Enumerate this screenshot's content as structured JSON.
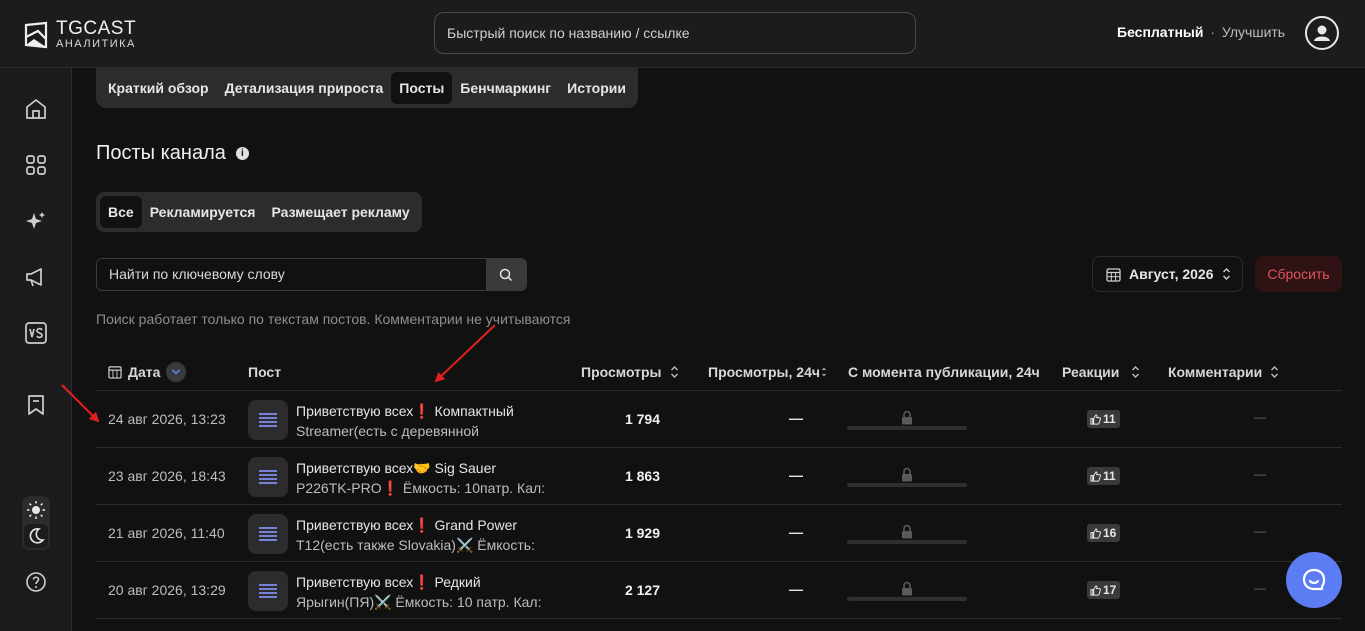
{
  "header": {
    "logo_line1": "TGCAST",
    "logo_line2": "АНАЛИТИКА",
    "search_placeholder": "Быстрый поиск по названию / ссылке",
    "plan_label": "Бесплатный",
    "plan_separator": "·",
    "upgrade_label": "Улучшить"
  },
  "sidebar": {
    "items": [
      {
        "icon": "home-icon"
      },
      {
        "icon": "grid-icon"
      },
      {
        "icon": "sparkles-icon"
      },
      {
        "icon": "megaphone-icon"
      },
      {
        "icon": "vs-icon"
      },
      {
        "icon": "bookmark-icon"
      }
    ],
    "theme": {
      "light": "sun-icon",
      "dark": "moon-icon",
      "selected": "dark"
    },
    "help_icon": "help-icon"
  },
  "tabs": [
    {
      "label": "Краткий обзор",
      "active": false
    },
    {
      "label": "Детализация прироста",
      "active": false
    },
    {
      "label": "Посты",
      "active": true
    },
    {
      "label": "Бенчмаркинг",
      "active": false
    },
    {
      "label": "Истории",
      "active": false
    }
  ],
  "page": {
    "title": "Посты канала",
    "info_icon": "info-icon"
  },
  "filters": [
    {
      "label": "Все",
      "active": true
    },
    {
      "label": "Рекламируется",
      "active": false
    },
    {
      "label": "Размещает рекламу",
      "active": false
    }
  ],
  "keyword_search": {
    "placeholder": "Найти по ключевому слову"
  },
  "month_picker": {
    "label": "Август, 2026"
  },
  "reset_label": "Сбросить",
  "hint": "Поиск работает только по текстам постов. Комментарии не учитываются",
  "table": {
    "columns": [
      "Дата",
      "Пост",
      "Просмотры",
      "Просмотры, 24ч",
      "С момента публикации, 24ч",
      "Реакции",
      "Комментарии"
    ],
    "rows": [
      {
        "date": "24 авг 2026, 13:23",
        "post_line1": "Приветствую всех❗ Компактный",
        "post_line2": "Streamer(есть с деревянной",
        "views": "1 794",
        "views_24h": "—",
        "reactions": "11",
        "comments": "—"
      },
      {
        "date": "23 авг 2026, 18:43",
        "post_line1": "Приветствую всех🤝 Sig Sauer",
        "post_line2": "P226TK-PRO❗ Ёмкость: 10патр. Кал:",
        "views": "1 863",
        "views_24h": "—",
        "reactions": "11",
        "comments": "—"
      },
      {
        "date": "21 авг 2026, 11:40",
        "post_line1": "Приветствую всех❗ Grand Power",
        "post_line2": "T12(есть также Slovakia)⚔️ Ёмкость:",
        "views": "1 929",
        "views_24h": "—",
        "reactions": "16",
        "comments": "—"
      },
      {
        "date": "20 авг 2026, 13:29",
        "post_line1": "Приветствую всех❗ Редкий",
        "post_line2": "Ярыгин(ПЯ)⚔️ Ёмкость: 10 патр. Кал:",
        "views": "2 127",
        "views_24h": "—",
        "reactions": "17",
        "comments": "—"
      }
    ]
  },
  "colors": {
    "background": "#111112",
    "panel": "#1c1c1e",
    "accent": "#5b7cf2",
    "reset_text": "#e0555c",
    "annotation_arrow": "#e0201c"
  },
  "chat_button_icon": "chat-icon"
}
